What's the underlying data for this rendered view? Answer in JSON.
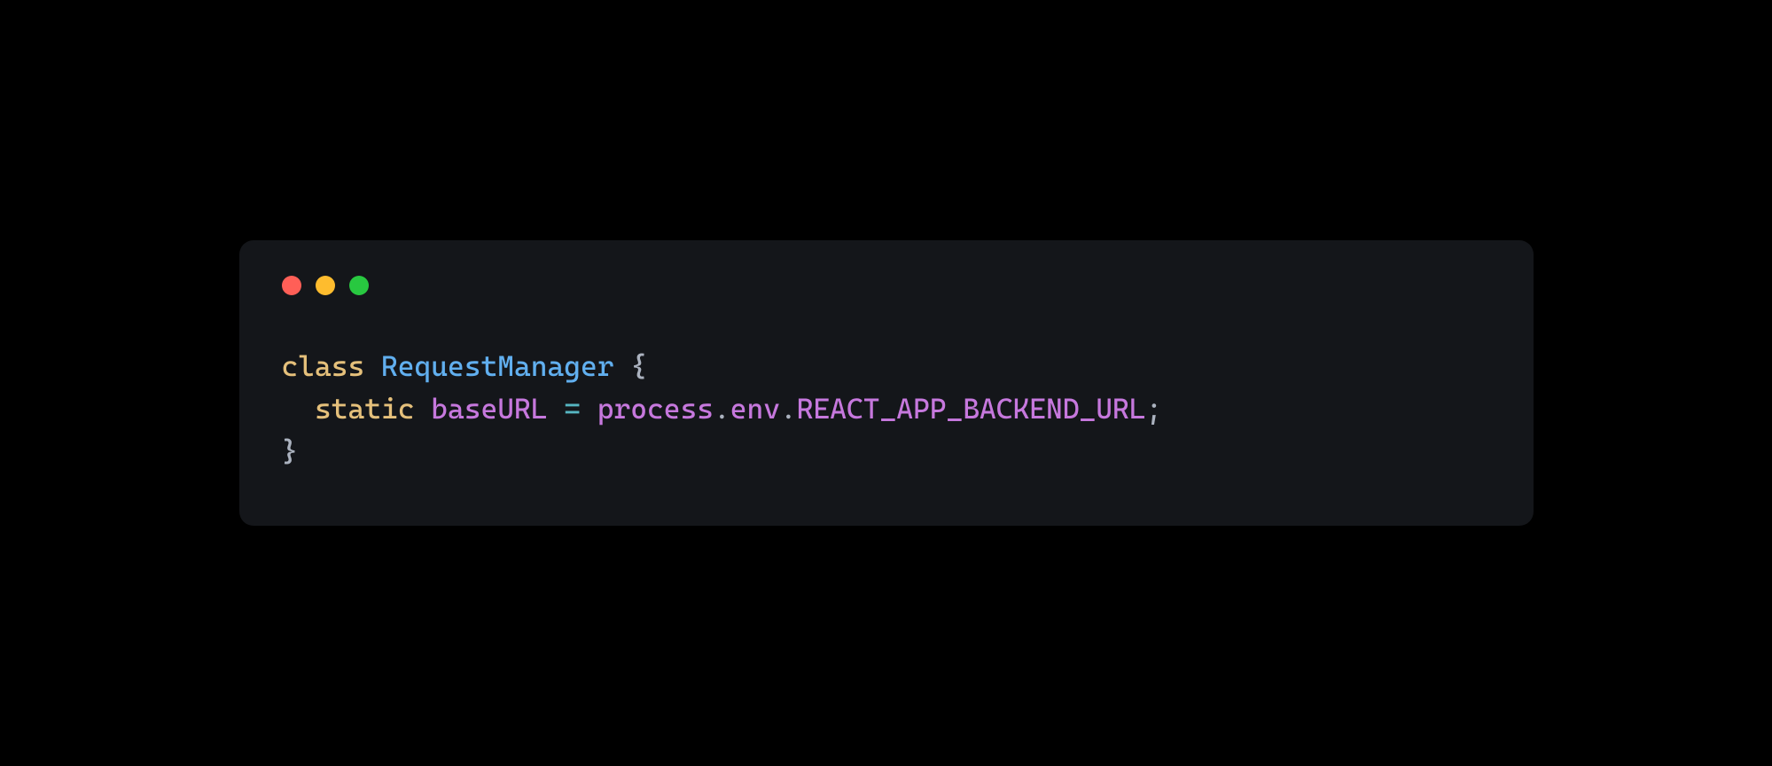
{
  "colors": {
    "close": "#ff5f57",
    "minimize": "#febc2e",
    "maximize": "#28c840",
    "background": "#14161a"
  },
  "code": {
    "line1": {
      "keyword": "class",
      "space1": " ",
      "className": "RequestManager",
      "space2": " ",
      "openBrace": "{"
    },
    "line2": {
      "indent": "  ",
      "static": "static",
      "space1": " ",
      "prop": "baseURL",
      "space2": " ",
      "equals": "=",
      "space3": " ",
      "obj1": "process",
      "dot1": ".",
      "obj2": "env",
      "dot2": ".",
      "obj3": "REACT_APP_BACKEND_URL",
      "semi": ";"
    },
    "line3": {
      "closeBrace": "}"
    }
  }
}
